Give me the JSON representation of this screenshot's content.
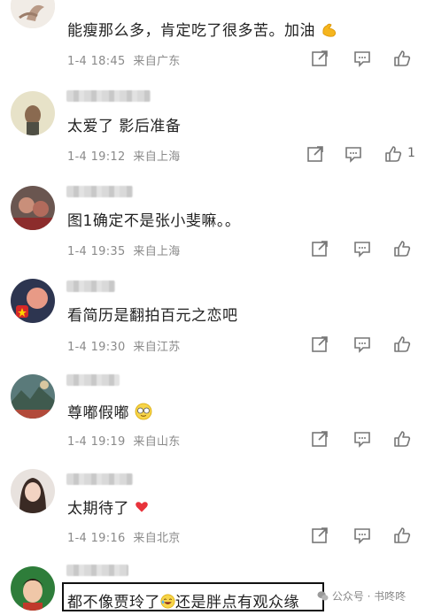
{
  "comments": [
    {
      "text": "能瘦那么多，肯定吃了很多苦。加油",
      "date": "1-4 18:45",
      "location": "来自广东",
      "likes": ""
    },
    {
      "text": "太爱了 影后准备",
      "date": "1-4 19:12",
      "location": "来自上海",
      "likes": "1"
    },
    {
      "text": "图1确定不是张小斐嘛。。",
      "date": "1-4 19:35",
      "location": "来自上海",
      "likes": ""
    },
    {
      "text": "看简历是翻拍百元之恋吧",
      "date": "1-4 19:30",
      "location": "来自江苏",
      "likes": ""
    },
    {
      "text": "尊嘟假嘟",
      "date": "1-4 19:19",
      "location": "来自山东",
      "likes": ""
    },
    {
      "text": "太期待了",
      "date": "1-4 19:16",
      "location": "来自北京",
      "likes": ""
    },
    {
      "text_a": "都不像贾玲了",
      "text_b": "还是胖点有观众缘"
    }
  ],
  "watermark": "公众号 · 书咚咚",
  "colors": {
    "text": "#222222",
    "meta": "#8a8a8a",
    "icon": "#777777",
    "heart": "#e8333b"
  }
}
